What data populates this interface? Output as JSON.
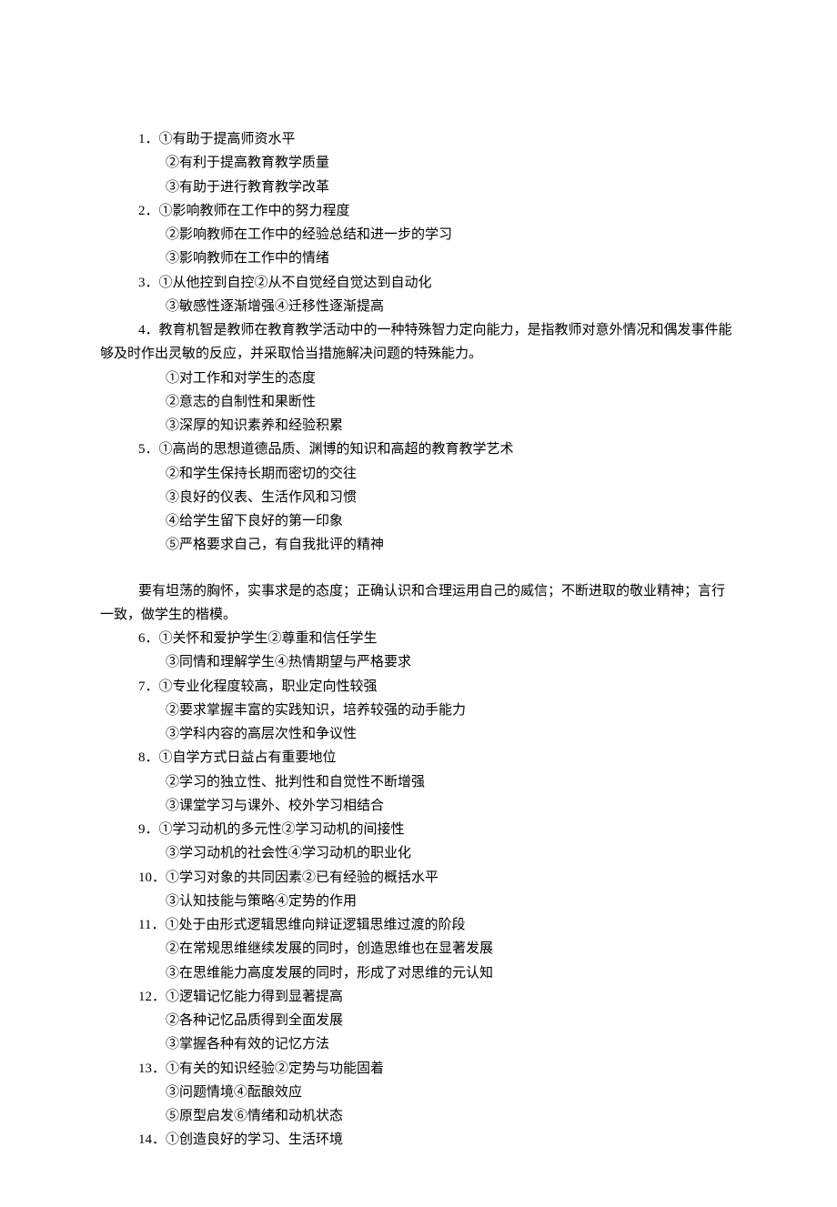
{
  "items": [
    {
      "cls": "numbered",
      "key": "l1"
    },
    {
      "cls": "sub",
      "key": "l2"
    },
    {
      "cls": "sub",
      "key": "l3"
    },
    {
      "cls": "numbered",
      "key": "l4"
    },
    {
      "cls": "sub",
      "key": "l5"
    },
    {
      "cls": "sub",
      "key": "l6"
    },
    {
      "cls": "numbered",
      "key": "l7"
    },
    {
      "cls": "sub",
      "key": "l8"
    },
    {
      "cls": "numbered",
      "key": "l9"
    },
    {
      "cls": "wraptext",
      "key": "l10"
    },
    {
      "cls": "sub",
      "key": "l11"
    },
    {
      "cls": "sub",
      "key": "l12"
    },
    {
      "cls": "sub",
      "key": "l13"
    },
    {
      "cls": "numbered",
      "key": "l14"
    },
    {
      "cls": "sub",
      "key": "l15"
    },
    {
      "cls": "sub",
      "key": "l16"
    },
    {
      "cls": "sub",
      "key": "l17"
    },
    {
      "cls": "sub",
      "key": "l18"
    },
    {
      "cls": "spacer",
      "key": ""
    },
    {
      "cls": "answerblock",
      "key": "l19"
    },
    {
      "cls": "wraptext",
      "key": "l20"
    },
    {
      "cls": "numbered",
      "key": "l21"
    },
    {
      "cls": "sub",
      "key": "l22"
    },
    {
      "cls": "numbered",
      "key": "l23"
    },
    {
      "cls": "sub",
      "key": "l24"
    },
    {
      "cls": "sub",
      "key": "l25"
    },
    {
      "cls": "numbered",
      "key": "l26"
    },
    {
      "cls": "sub",
      "key": "l27"
    },
    {
      "cls": "sub",
      "key": "l28"
    },
    {
      "cls": "numbered",
      "key": "l29"
    },
    {
      "cls": "sub",
      "key": "l30"
    },
    {
      "cls": "numbered",
      "key": "l31"
    },
    {
      "cls": "sub",
      "key": "l32"
    },
    {
      "cls": "numbered",
      "key": "l33"
    },
    {
      "cls": "sub",
      "key": "l34"
    },
    {
      "cls": "sub",
      "key": "l35"
    },
    {
      "cls": "numbered",
      "key": "l36"
    },
    {
      "cls": "sub",
      "key": "l37"
    },
    {
      "cls": "sub",
      "key": "l38"
    },
    {
      "cls": "numbered",
      "key": "l39"
    },
    {
      "cls": "sub",
      "key": "l40"
    },
    {
      "cls": "sub",
      "key": "l41"
    },
    {
      "cls": "numbered",
      "key": "l42"
    }
  ],
  "text": {
    "l1": "1．①有助于提高师资水平",
    "l2": "②有利于提高教育教学质量",
    "l3": "③有助于进行教育教学改革",
    "l4": "2．①影响教师在工作中的努力程度",
    "l5": "②影响教师在工作中的经验总结和进一步的学习",
    "l6": "③影响教师在工作中的情绪",
    "l7": "3．①从他控到自控②从不自觉经自觉达到自动化",
    "l8": "③敏感性逐渐增强④迁移性逐渐提高",
    "l9": "4．教育机智是教师在教育教学活动中的一种特殊智力定向能力，是指教师对意外情况和偶发事件能",
    "l10": "够及时作出灵敏的反应，并采取恰当措施解决问题的特殊能力。",
    "l11": "①对工作和对学生的态度",
    "l12": "②意志的自制性和果断性",
    "l13": "③深厚的知识素养和经验积累",
    "l14": "5．①高尚的思想道德品质、渊博的知识和高超的教育教学艺术",
    "l15": "②和学生保持长期而密切的交往",
    "l16": "③良好的仪表、生活作风和习惯",
    "l17": "④给学生留下良好的第一印象",
    "l18": "⑤严格要求自己，有自我批评的精神",
    "l19": "要有坦荡的胸怀，实事求是的态度；正确认识和合理运用自己的威信；不断进取的敬业精神；言行",
    "l20": "一致，做学生的楷模。",
    "l21": "6．①关怀和爱护学生②尊重和信任学生",
    "l22": "③同情和理解学生④热情期望与严格要求",
    "l23": "7．①专业化程度较高，职业定向性较强",
    "l24": "②要求掌握丰富的实践知识，培养较强的动手能力",
    "l25": "③学科内容的高层次性和争议性",
    "l26": "8．①自学方式日益占有重要地位",
    "l27": "②学习的独立性、批判性和自觉性不断增强",
    "l28": "③课堂学习与课外、校外学习相结合",
    "l29": "9．①学习动机的多元性②学习动机的间接性",
    "l30": "③学习动机的社会性④学习动机的职业化",
    "l31": "10．①学习对象的共同因素②已有经验的概括水平",
    "l32": "③认知技能与策略④定势的作用",
    "l33": "11．①处于由形式逻辑思维向辩证逻辑思维过渡的阶段",
    "l34": "②在常规思维继续发展的同时，创造思维也在显著发展",
    "l35": "③在思维能力高度发展的同时，形成了对思维的元认知",
    "l36": "12．①逻辑记忆能力得到显著提高",
    "l37": "②各种记忆品质得到全面发展",
    "l38": "③掌握各种有效的记忆方法",
    "l39": "13．①有关的知识经验②定势与功能固着",
    "l40": "③问题情境④酝酿效应",
    "l41": "⑤原型启发⑥情绪和动机状态",
    "l42": "14．①创造良好的学习、生活环境"
  }
}
